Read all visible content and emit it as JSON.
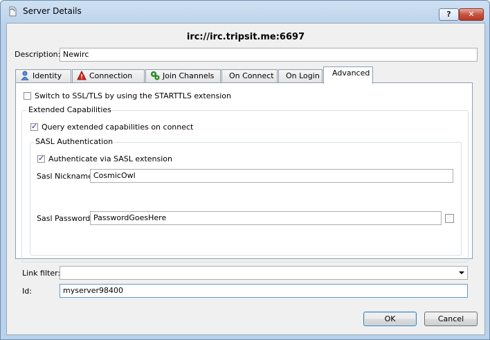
{
  "window": {
    "title": "Server Details",
    "help_label": "?",
    "close_label": "✕"
  },
  "server_address": "irc://irc.tripsit.me:6697",
  "description": {
    "label": "Description:",
    "value": "Newirc"
  },
  "tabs": [
    {
      "label": "Identity",
      "icon": "person-icon"
    },
    {
      "label": "Connection",
      "icon": "warning-icon"
    },
    {
      "label": "Join Channels",
      "icon": "gears-icon"
    },
    {
      "label": "On Connect",
      "icon": ""
    },
    {
      "label": "On Login",
      "icon": ""
    },
    {
      "label": "Advanced",
      "icon": ""
    }
  ],
  "active_tab": "Advanced",
  "advanced": {
    "starttls_label": "Switch to SSL/TLS by using the STARTTLS extension",
    "starttls_checked": false,
    "extended_caps_title": "Extended Capabilities",
    "query_caps_label": "Query extended capabilities on connect",
    "query_caps_checked": true,
    "sasl_title": "SASL Authentication",
    "sasl_auth_label": "Authenticate via SASL extension",
    "sasl_auth_checked": true,
    "sasl_nick_label": "Sasl Nickname:",
    "sasl_nick_value": "CosmicOwl",
    "sasl_pass_label": "Sasl Password:",
    "sasl_pass_value": "PasswordGoesHere",
    "show_password_checked": false
  },
  "link_filter": {
    "label": "Link filter:",
    "value": ""
  },
  "id_field": {
    "label": "Id:",
    "value": "myserver98400"
  },
  "buttons": {
    "ok": "OK",
    "cancel": "Cancel"
  }
}
